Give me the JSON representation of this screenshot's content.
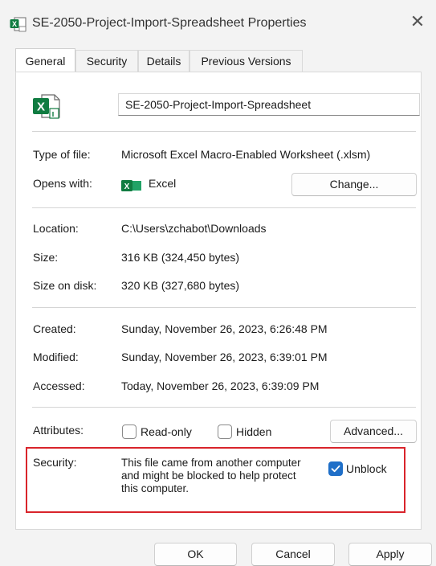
{
  "window": {
    "title": "SE-2050-Project-Import-Spreadsheet Properties",
    "close_symbol": "✕"
  },
  "tabs": [
    {
      "label": "General",
      "active": true
    },
    {
      "label": "Security",
      "active": false
    },
    {
      "label": "Details",
      "active": false
    },
    {
      "label": "Previous Versions",
      "active": false
    }
  ],
  "file": {
    "name": "SE-2050-Project-Import-Spreadsheet",
    "icon": "excel-file-icon"
  },
  "type_section": {
    "type_label": "Type of file:",
    "type_value": "Microsoft Excel Macro-Enabled Worksheet (.xlsm)",
    "opens_label": "Opens with:",
    "opens_value": "Excel",
    "opens_icon": "excel-icon",
    "change_button": "Change..."
  },
  "location_section": {
    "location_label": "Location:",
    "location_value": "C:\\Users\\zchabot\\Downloads",
    "size_label": "Size:",
    "size_value": "316 KB (324,450 bytes)",
    "size_disk_label": "Size on disk:",
    "size_disk_value": "320 KB (327,680 bytes)"
  },
  "dates_section": {
    "created_label": "Created:",
    "created_value": "Sunday, November 26, 2023, 6:26:48 PM",
    "modified_label": "Modified:",
    "modified_value": "Sunday, November 26, 2023, 6:39:01 PM",
    "accessed_label": "Accessed:",
    "accessed_value": "Today, November 26, 2023, 6:39:09 PM"
  },
  "attributes": {
    "label": "Attributes:",
    "readonly_label": "Read-only",
    "readonly_checked": false,
    "hidden_label": "Hidden",
    "hidden_checked": false,
    "advanced_button": "Advanced..."
  },
  "security": {
    "label": "Security:",
    "message": "This file came from another computer and might be blocked to help protect this computer.",
    "unblock_label": "Unblock",
    "unblock_checked": true,
    "highlight_color": "#d9242b"
  },
  "footer": {
    "ok": "OK",
    "cancel": "Cancel",
    "apply": "Apply"
  },
  "colors": {
    "accent": "#1f6fc8",
    "excel_green": "#107c41"
  }
}
